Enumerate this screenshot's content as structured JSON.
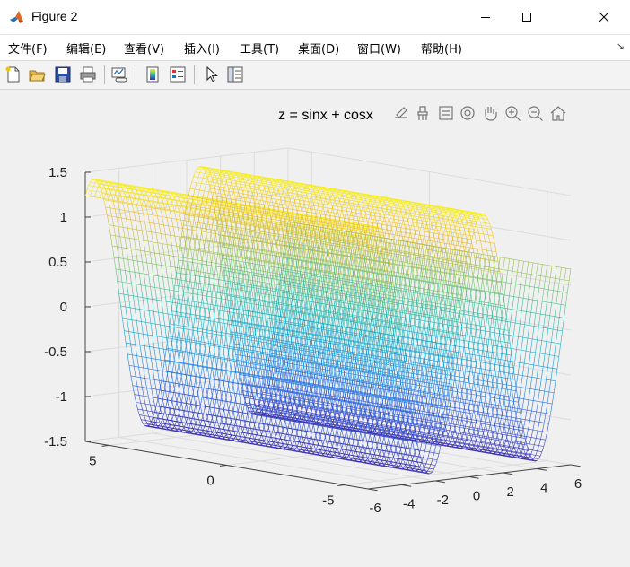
{
  "window": {
    "title": "Figure 2"
  },
  "menu": [
    "文件(F)",
    "编辑(E)",
    "查看(V)",
    "插入(I)",
    "工具(T)",
    "桌面(D)",
    "窗口(W)",
    "帮助(H)"
  ],
  "toolbar": {
    "buttons": [
      "new-figure-icon",
      "open-icon",
      "save-icon",
      "print-icon",
      "link-plot-icon",
      "colorbar-icon",
      "legend-icon",
      "pointer-icon",
      "property-editor-icon"
    ]
  },
  "axes_toolbar": {
    "buttons": [
      "export-icon",
      "brush-icon",
      "datatip-icon",
      "rotate-3d-icon",
      "pan-icon",
      "zoom-in-icon",
      "zoom-out-icon",
      "home-icon"
    ]
  },
  "chart_data": {
    "type": "surface",
    "title": "z = sinx + cosx",
    "function": "z = sin(x) + cos(x)",
    "x_range": [
      -6,
      6
    ],
    "y_range": [
      -6,
      6
    ],
    "z_range": [
      -1.5,
      1.5
    ],
    "x_ticks": [
      -6,
      -4,
      -2,
      0,
      2,
      4,
      6
    ],
    "y_ticks": [
      -5,
      0,
      5
    ],
    "z_ticks": [
      -1.5,
      -1,
      -0.5,
      0,
      0.5,
      1,
      1.5
    ],
    "x_tick_labels": [
      "-6",
      "-4",
      "-2",
      "0",
      "2",
      "4",
      "6"
    ],
    "y_tick_labels": [
      "-5",
      "0",
      "5"
    ],
    "z_tick_labels": [
      "-1.5",
      "-1",
      "-0.5",
      "0",
      "0.5",
      "1",
      "1.5"
    ],
    "colormap": "parula",
    "grid": true,
    "box": false
  }
}
